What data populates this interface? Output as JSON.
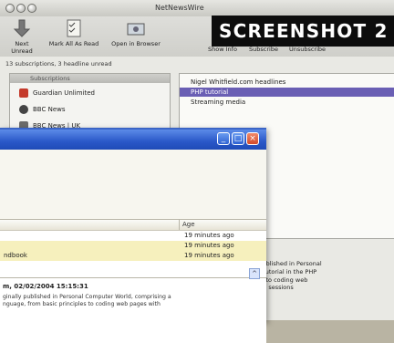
{
  "mac": {
    "window_title": "NetNewsWire",
    "toolbar": {
      "next_unread": "Next Unread",
      "mark_all_read": "Mark All As Read",
      "open_in_browser": "Open in Browser",
      "show_info": "Show Info",
      "subscribe": "Subscribe",
      "unsubscribe": "Unsubscribe"
    },
    "status": "13 subscriptions, 3 headline unread",
    "sidebar": {
      "header": "Subscriptions",
      "items": [
        {
          "label": "Guardian Unlimited",
          "icon": "guardian-icon",
          "color": "#c43a2b"
        },
        {
          "label": "BBC News",
          "icon": "bbc-icon",
          "color": "#444444"
        },
        {
          "label": "BBC News | UK",
          "icon": "bbc-icon",
          "color": "#6b6b6b"
        }
      ]
    },
    "headlines": [
      {
        "label": "Nigel Whitfield.com headlines",
        "selected": false
      },
      {
        "label": "PHP tutorial",
        "selected": true
      },
      {
        "label": "Streaming media",
        "selected": false
      }
    ],
    "preview": [
      "iginally published in Personal",
      "prising a tutorial in the PHP",
      "principles to coding web",
      "o handling sessions"
    ]
  },
  "banner": {
    "text": "SCREENSHOT 2"
  },
  "win": {
    "grid": {
      "age_header": "Age",
      "rows": [
        {
          "title": "",
          "age": "19 minutes ago"
        },
        {
          "title": "",
          "age": "19 minutes ago"
        },
        {
          "title": "ndbook",
          "age": "19 minutes ago"
        }
      ]
    },
    "detail": {
      "heading": "m, 02/02/2004 15:15:31",
      "lines": [
        "ginally published in Personal Computer World, comprising a",
        "nguage, from basic principles to coding web pages with"
      ]
    }
  },
  "colors": {
    "selected": "#6a5fb4",
    "grid_highlight": "#f6f0bd",
    "xp_blue": "#2a58c8"
  }
}
